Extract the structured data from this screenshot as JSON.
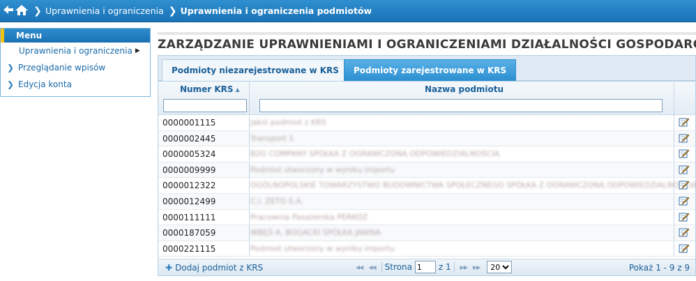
{
  "breadcrumb": {
    "items": [
      "Uprawnienia i ograniczenia",
      "Uprawnienia i ograniczenia podmiotów"
    ]
  },
  "menu": {
    "title": "Menu",
    "items": [
      {
        "label": "Uprawnienia i ograniczenia",
        "active": true
      },
      {
        "label": "Przeglądanie wpisów",
        "active": false
      },
      {
        "label": "Edycja konta",
        "active": false
      }
    ]
  },
  "page": {
    "title": "ZARZĄDZANIE UPRAWNIENIAMI I OGRANICZENIAMI DZIAŁALNOŚCI GOSPODARCZEJ"
  },
  "tabs": [
    {
      "label": "Podmioty niezarejestrowane w KRS",
      "active": false
    },
    {
      "label": "Podmioty zarejestrowane w KRS",
      "active": true
    }
  ],
  "grid": {
    "columns": {
      "krs": "Numer KRS",
      "name": "Nazwa podmiotu"
    },
    "filters": {
      "krs": "",
      "name": ""
    },
    "rows": [
      {
        "krs": "0000001115",
        "name": "Jakiś podmiot z KRS"
      },
      {
        "krs": "0000002445",
        "name": "Transport 1"
      },
      {
        "krs": "0000005324",
        "name": "B2G COMPANY SPÓŁKA Z OGRANICZONĄ ODPOWIEDZIALNOŚCIĄ"
      },
      {
        "krs": "0000009999",
        "name": "Podmiot utworzony w wyniku importu"
      },
      {
        "krs": "0000012322",
        "name": "OGÓLNOPOLSKIE TOWARZYSTWO BUDOWNICTWA SPOŁECZNEGO SPÓŁKA Z OGRANICZONĄ ODPOWIEDZIALNOŚCIĄ"
      },
      {
        "krs": "0000012499",
        "name": "C.I. ZETO S.A."
      },
      {
        "krs": "0000111111",
        "name": "Pracownia Pasażerska PERKOZ"
      },
      {
        "krs": "0000187059",
        "name": "WBĘŚ A. BOGACKI SPÓŁKA JAWNA"
      },
      {
        "krs": "0000221115",
        "name": "Podmiot utworzony w wyniku importu"
      }
    ],
    "footer": {
      "add_label": "Dodaj podmiot z KRS",
      "page_label": "Strona",
      "page_value": "1",
      "of_label": "z 1",
      "page_size": "20",
      "records": "Pokaż 1 - 9 z 9"
    }
  }
}
